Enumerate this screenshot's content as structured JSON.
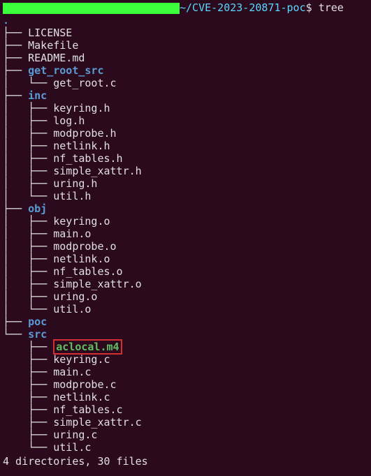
{
  "prompt": {
    "path": "~/CVE-2023-20871-poc",
    "symbol": "$",
    "command": "tree"
  },
  "root_dot": ".",
  "tree": [
    {
      "indent": "├── ",
      "name": "LICENSE",
      "type": "file"
    },
    {
      "indent": "├── ",
      "name": "Makefile",
      "type": "file"
    },
    {
      "indent": "├── ",
      "name": "README.md",
      "type": "file"
    },
    {
      "indent": "├── ",
      "name": "get_root_src",
      "type": "dir"
    },
    {
      "indent": "│   └── ",
      "name": "get_root.c",
      "type": "file"
    },
    {
      "indent": "├── ",
      "name": "inc",
      "type": "dir"
    },
    {
      "indent": "│   ├── ",
      "name": "keyring.h",
      "type": "file"
    },
    {
      "indent": "│   ├── ",
      "name": "log.h",
      "type": "file"
    },
    {
      "indent": "│   ├── ",
      "name": "modprobe.h",
      "type": "file"
    },
    {
      "indent": "│   ├── ",
      "name": "netlink.h",
      "type": "file"
    },
    {
      "indent": "│   ├── ",
      "name": "nf_tables.h",
      "type": "file"
    },
    {
      "indent": "│   ├── ",
      "name": "simple_xattr.h",
      "type": "file"
    },
    {
      "indent": "│   ├── ",
      "name": "uring.h",
      "type": "file"
    },
    {
      "indent": "│   └── ",
      "name": "util.h",
      "type": "file"
    },
    {
      "indent": "├── ",
      "name": "obj",
      "type": "dir"
    },
    {
      "indent": "│   ├── ",
      "name": "keyring.o",
      "type": "file"
    },
    {
      "indent": "│   ├── ",
      "name": "main.o",
      "type": "file"
    },
    {
      "indent": "│   ├── ",
      "name": "modprobe.o",
      "type": "file"
    },
    {
      "indent": "│   ├── ",
      "name": "netlink.o",
      "type": "file"
    },
    {
      "indent": "│   ├── ",
      "name": "nf_tables.o",
      "type": "file"
    },
    {
      "indent": "│   ├── ",
      "name": "simple_xattr.o",
      "type": "file"
    },
    {
      "indent": "│   ├── ",
      "name": "uring.o",
      "type": "file"
    },
    {
      "indent": "│   └── ",
      "name": "util.o",
      "type": "file"
    },
    {
      "indent": "├── ",
      "name": "poc",
      "type": "dir"
    },
    {
      "indent": "└── ",
      "name": "src",
      "type": "dir"
    },
    {
      "indent": "    ├── ",
      "name": "aclocal.m4",
      "type": "highlighted"
    },
    {
      "indent": "    ├── ",
      "name": "keyring.c",
      "type": "file"
    },
    {
      "indent": "    ├── ",
      "name": "main.c",
      "type": "file"
    },
    {
      "indent": "    ├── ",
      "name": "modprobe.c",
      "type": "file"
    },
    {
      "indent": "    ├── ",
      "name": "netlink.c",
      "type": "file"
    },
    {
      "indent": "    ├── ",
      "name": "nf_tables.c",
      "type": "file"
    },
    {
      "indent": "    ├── ",
      "name": "simple_xattr.c",
      "type": "file"
    },
    {
      "indent": "    ├── ",
      "name": "uring.c",
      "type": "file"
    },
    {
      "indent": "    └── ",
      "name": "util.c",
      "type": "file"
    }
  ],
  "summary": "4 directories, 30 files"
}
